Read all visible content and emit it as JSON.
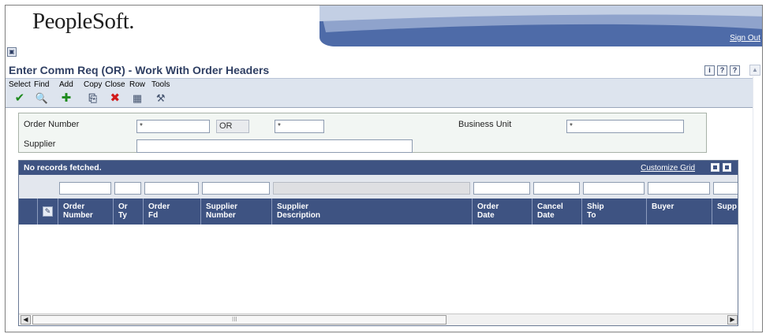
{
  "header": {
    "brand": "PeopleSoft.",
    "sign_out": "Sign Out"
  },
  "page": {
    "title": "Enter Comm Req (OR) - Work With Order Headers",
    "help_icons": [
      "i",
      "?",
      "?"
    ]
  },
  "toolbar": {
    "items": [
      {
        "label": "Select",
        "icon": "check-icon"
      },
      {
        "label": "Find",
        "icon": "find-icon"
      },
      {
        "label": "Add",
        "icon": "plus-icon"
      },
      {
        "label": "Copy",
        "icon": "copy-icon"
      },
      {
        "label": "Close",
        "icon": "close-icon"
      },
      {
        "label": "Row",
        "icon": "row-icon"
      },
      {
        "label": "Tools",
        "icon": "tools-icon"
      }
    ]
  },
  "form": {
    "order_number_label": "Order Number",
    "order_number_value": "*",
    "order_type_value": "OR",
    "order_company_value": "*",
    "business_unit_label": "Business Unit",
    "business_unit_value": "*",
    "supplier_label": "Supplier",
    "supplier_value": ""
  },
  "grid": {
    "status": "No records fetched.",
    "customize": "Customize Grid",
    "columns": [
      "Order Number",
      "Or Ty",
      "Order Fd",
      "Supplier Number",
      "Supplier Description",
      "Order Date",
      "Cancel Date",
      "Ship To",
      "Buyer",
      "Supp"
    ],
    "rows": []
  },
  "colors": {
    "header_blue": "#3e5382",
    "title_blue": "#2f3f63",
    "toolbar_bg": "#dde4ee",
    "form_bg": "#f2f6f3"
  }
}
